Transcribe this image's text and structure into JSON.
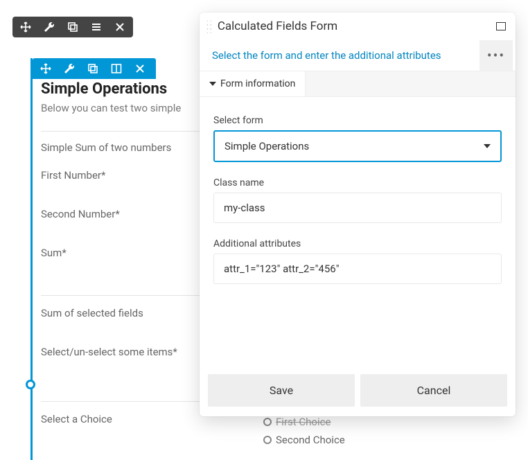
{
  "topToolbar": {
    "icons": [
      "move",
      "wrench",
      "copy",
      "menu",
      "close"
    ]
  },
  "blueToolbar": {
    "icons": [
      "move",
      "wrench",
      "copy",
      "columns",
      "close"
    ]
  },
  "page": {
    "title": "Simple Operations",
    "subtitle": "Below you can test two simple",
    "fields": [
      "Simple Sum of two numbers",
      "First Number*",
      "Second Number*",
      "Sum*",
      "Sum of selected fields",
      "Select/un-select some items*",
      "Select a Choice"
    ]
  },
  "choices": {
    "first": "First Choice",
    "second": "Second Choice"
  },
  "panel": {
    "title": "Calculated Fields Form",
    "hint": "Select the form and enter the additional attributes",
    "more": "•••",
    "tab": "Form information",
    "selectLabel": "Select form",
    "selectValue": "Simple Operations",
    "classLabel": "Class name",
    "classValue": "my-class",
    "attrLabel": "Additional attributes",
    "attrValue": "attr_1=\"123\" attr_2=\"456\"",
    "save": "Save",
    "cancel": "Cancel"
  }
}
